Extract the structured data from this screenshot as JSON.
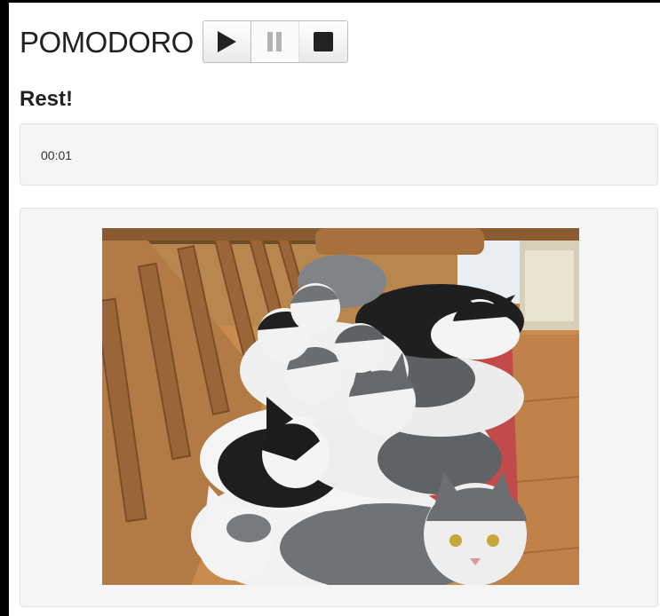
{
  "header": {
    "title": "POMODORO",
    "controls": [
      {
        "name": "play",
        "icon": "play-icon"
      },
      {
        "name": "pause",
        "icon": "pause-icon",
        "disabled": true
      },
      {
        "name": "stop",
        "icon": "stop-icon"
      }
    ]
  },
  "status": {
    "text": "Rest!"
  },
  "timer": {
    "display": "00:01"
  },
  "image": {
    "subject": "cats-photo"
  },
  "colors": {
    "title": "#222222",
    "well_bg": "#f5f5f5",
    "well_border": "#e3e3e3",
    "icon": "#222222"
  }
}
